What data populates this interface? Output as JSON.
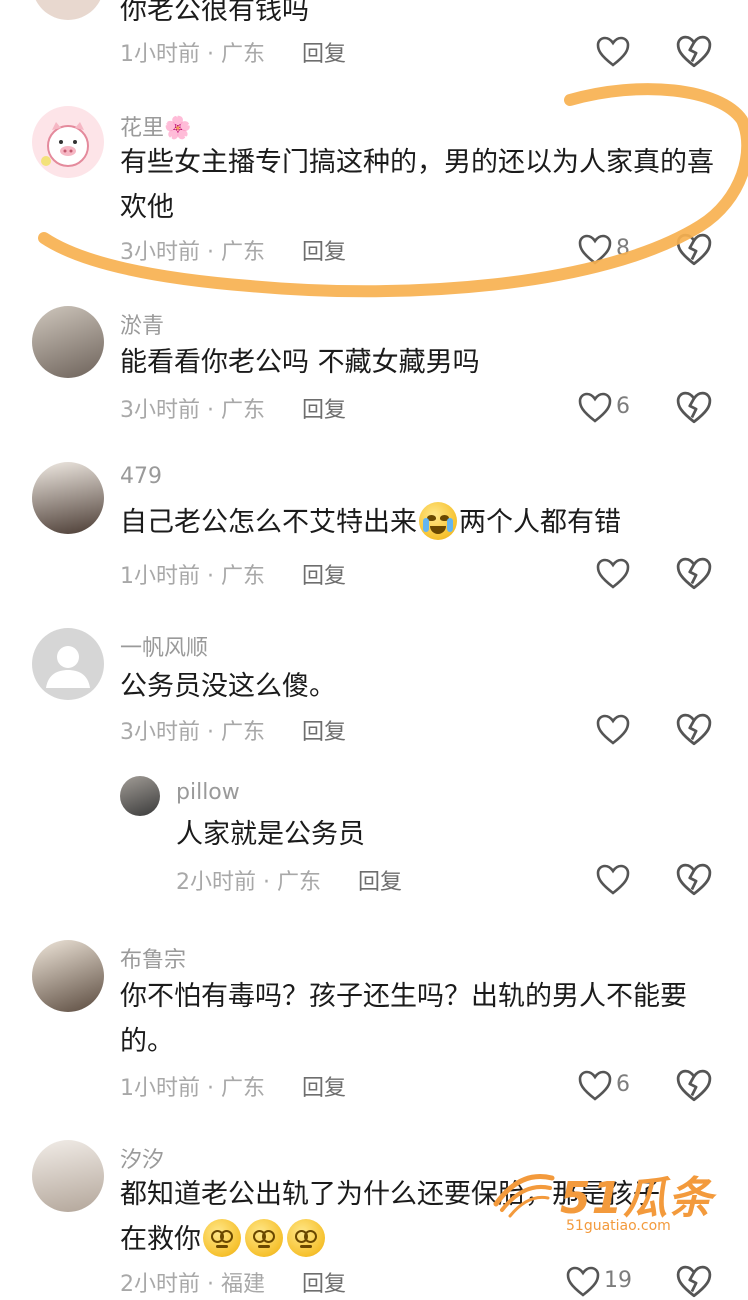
{
  "comments": [
    {
      "name": "",
      "text": "你老公很有钱吗",
      "time": "1小时前",
      "location": "广东",
      "reply": "回复",
      "likes": ""
    },
    {
      "name": "花里🌸",
      "text": "有些女主播专门搞这种的，男的还以为人家真的喜欢他",
      "time": "3小时前",
      "location": "广东",
      "reply": "回复",
      "likes": "8"
    },
    {
      "name": "淤青",
      "text": "能看看你老公吗 不藏女藏男吗",
      "time": "3小时前",
      "location": "广东",
      "reply": "回复",
      "likes": "6"
    },
    {
      "name": "479",
      "text_before": "自己老公怎么不艾特出来",
      "text_after": "两个人都有错",
      "time": "1小时前",
      "location": "广东",
      "reply": "回复",
      "likes": ""
    },
    {
      "name": "一帆风顺",
      "text": "公务员没这么傻。",
      "time": "3小时前",
      "location": "广东",
      "reply": "回复",
      "likes": ""
    },
    {
      "name": "pillow",
      "text": "人家就是公务员",
      "time": "2小时前",
      "location": "广东",
      "reply": "回复",
      "likes": ""
    },
    {
      "name": "布鲁宗",
      "text": "你不怕有毒吗？孩子还生吗？出轨的男人不能要的。",
      "time": "1小时前",
      "location": "广东",
      "reply": "回复",
      "likes": "6"
    },
    {
      "name": "汐汐",
      "text": "都知道老公出轨了为什么还要保胎，那是孩子在救你",
      "time": "2小时前",
      "location": "福建",
      "reply": "回复",
      "likes": "19"
    }
  ],
  "separator": "·",
  "icons": {
    "like": "heart-outline-icon",
    "dislike": "broken-heart-icon",
    "emoji_cry": "crying-face-emoji",
    "emoji_dizzy": "dizzy-face-emoji"
  },
  "watermark": {
    "brand": "51瓜条",
    "url": "51guatiao.com"
  },
  "colors": {
    "highlight": "#f7b150",
    "watermark": "#f39a3c"
  }
}
